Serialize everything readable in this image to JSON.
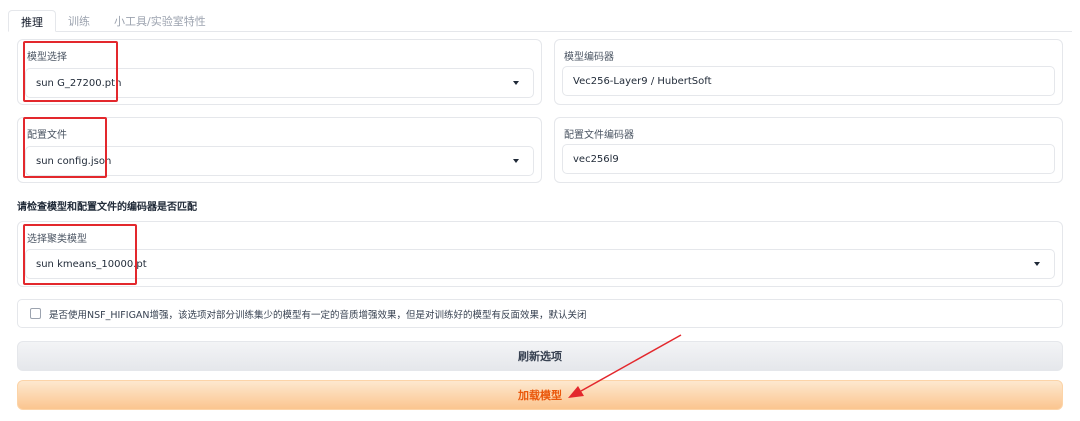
{
  "tabs": [
    {
      "label": "推理",
      "active": true
    },
    {
      "label": "训练",
      "active": false
    },
    {
      "label": "小工具/实验室特性",
      "active": false
    }
  ],
  "model_select": {
    "label": "模型选择",
    "value": "sun G_27200.pth"
  },
  "model_encoder": {
    "label": "模型编码器",
    "value": "Vec256-Layer9 / HubertSoft"
  },
  "config_file": {
    "label": "配置文件",
    "value": "sun config.json"
  },
  "config_encoder": {
    "label": "配置文件编码器",
    "value": "vec256l9"
  },
  "hint": "请检查模型和配置文件的编码器是否匹配",
  "cluster_model": {
    "label": "选择聚类模型",
    "value": "sun kmeans_10000.pt"
  },
  "nsf_hifigan": {
    "label": "是否使用NSF_HIFIGAN增强，该选项对部分训练集少的模型有一定的音质增强效果，但是对训练好的模型有反面效果，默认关闭",
    "checked": false
  },
  "buttons": {
    "refresh": "刷新选项",
    "load": "加载模型"
  },
  "colors": {
    "annotation_red": "#e3282d",
    "load_button_text": "#ea580c",
    "load_button_fill": "#fbc58f"
  }
}
